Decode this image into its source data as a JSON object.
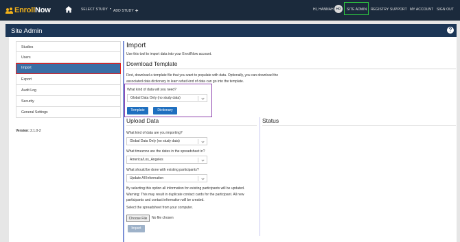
{
  "topnav": {
    "brand_enroll": "Enroll",
    "brand_now": "Now",
    "select_study": "SELECT STUDY",
    "add_study": "ADD STUDY",
    "greeting": "HI, HANNAH",
    "avatar_initials": "HO",
    "site_admin": "SITE ADMIN",
    "registry": "REGISTRY",
    "support": "SUPPORT",
    "my_account": "MY ACCOUNT",
    "sign_out": "SIGN OUT"
  },
  "header": {
    "title": "Site Admin",
    "help": "?"
  },
  "sidebar": {
    "items": [
      {
        "label": "Studies"
      },
      {
        "label": "Users"
      },
      {
        "label": "Import"
      },
      {
        "label": "Export"
      },
      {
        "label": "Audit Log"
      },
      {
        "label": "Security"
      },
      {
        "label": "General Settings"
      }
    ],
    "version_label": "Version:",
    "version_value": "2.1.0-2"
  },
  "main": {
    "title": "Import",
    "intro": "Use this tool to import data into your EnrollNow account.",
    "download_title": "Download Template",
    "download_text": "First, download a template file that you want to populate with data. Optionally, you can download the associated data dictionary to learn what kind of data can go into the template.",
    "need_label": "What kind of data will you need?",
    "need_value": "Global Data Only (no study data)",
    "template_button": "Template",
    "dictionary_button": "Dictionary",
    "upload_title": "Upload Data",
    "importing_label": "What kind of data are you importing?",
    "importing_value": "Global Data Only (no study data)",
    "timezone_label": "What timezone are the dates in the spreadsheet in?",
    "timezone_value": "America/Los_Angeles",
    "existing_label": "What should be done with existing participants?",
    "existing_value": "Update All Information",
    "warning_text": "By selecting this option all information for existing participants will be updated. Warning: This may result in duplicate contact cards for the participant. All new participants and contact information will be created.",
    "select_file_text": "Select the spreadsheet from your computer.",
    "choose_file": "Choose File",
    "no_file": "No file chosen",
    "import_button": "Import",
    "status_title": "Status"
  },
  "colors": {
    "topnav_bg": "#1b2a3c",
    "header_bg": "#1c3656",
    "brand_accent": "#f3b21a",
    "active_item": "#3a6ea5",
    "button_primary": "#1f6fbf",
    "highlight_green": "#2ecc40",
    "highlight_red": "#e02020",
    "highlight_purple": "#8e44ad"
  },
  "icons": {
    "brand": "people-group-icon",
    "home": "home-icon",
    "select_study": "chevron-down-icon",
    "add_study": "plus-icon",
    "help": "question-circle-icon",
    "select_arrow": "chevron-down-icon"
  }
}
